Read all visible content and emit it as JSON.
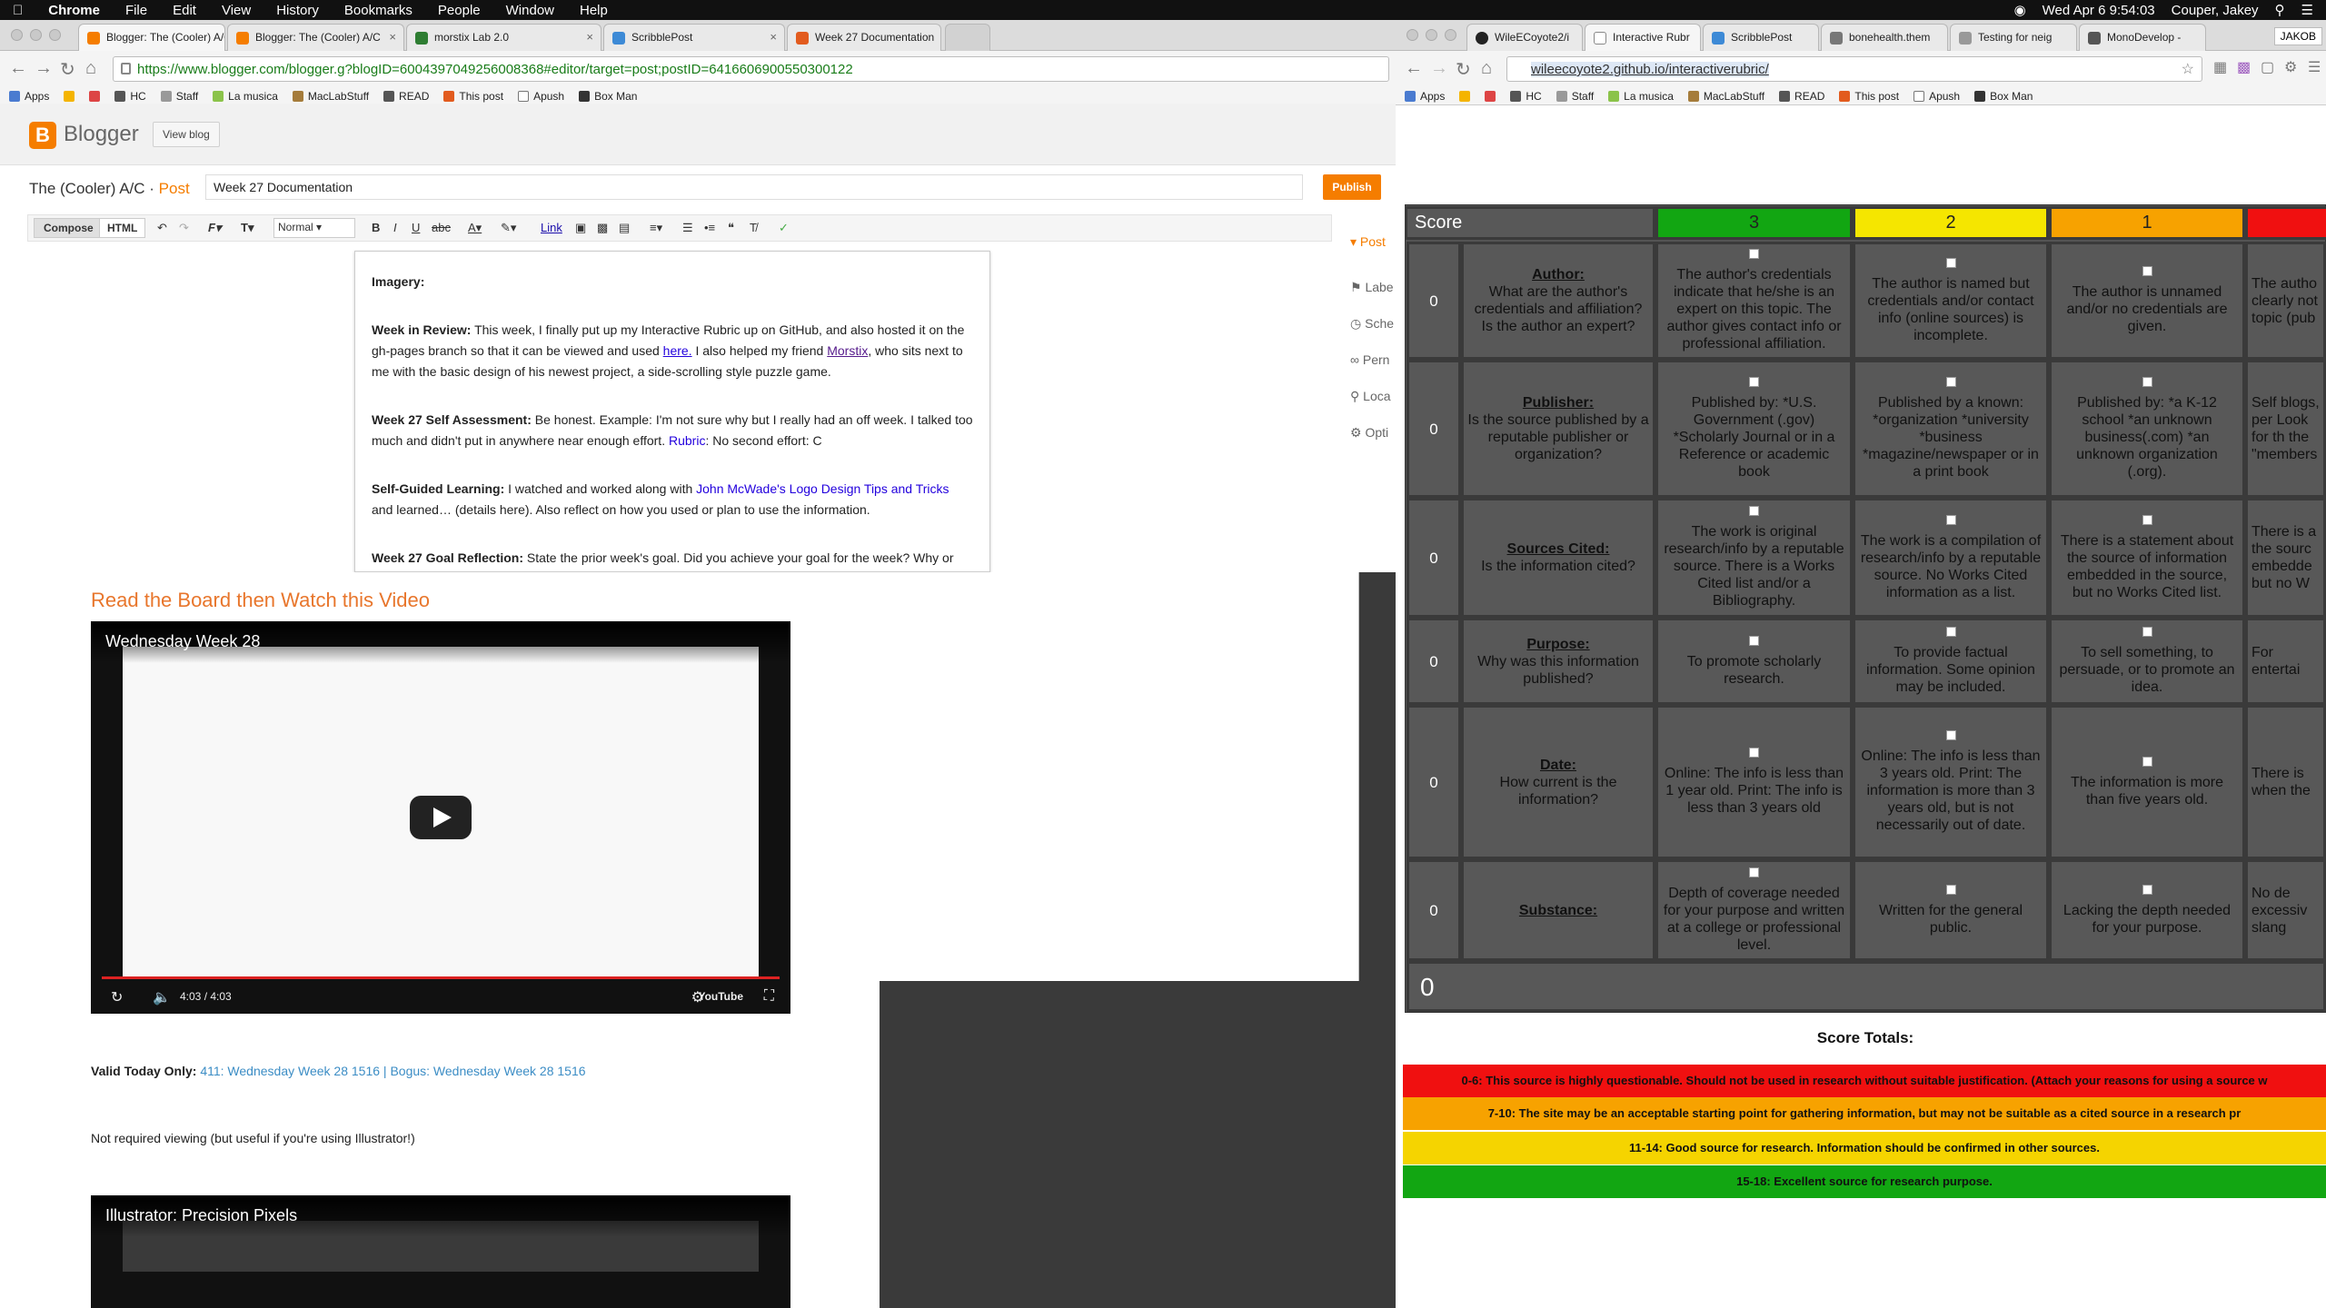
{
  "menubar": {
    "app": "Chrome",
    "items": [
      "File",
      "Edit",
      "View",
      "History",
      "Bookmarks",
      "People",
      "Window",
      "Help"
    ],
    "datetime": "Wed Apr 6  9:54:03",
    "user": "Couper, Jakey"
  },
  "left_browser": {
    "tabs": [
      {
        "label": "Blogger: The (Cooler) A/C",
        "color": "#f57d00"
      },
      {
        "label": "Blogger: The (Cooler) A/C",
        "color": "#f57d00"
      },
      {
        "label": "morstix Lab 2.0",
        "color": "#2e7d32"
      },
      {
        "label": "ScribblePost",
        "color": "#3d8ad6"
      },
      {
        "label": "Week 27 Documentation",
        "color": "#e25b1e"
      }
    ],
    "url": "https://www.blogger.com/blogger.g?blogID=6004397049256008368#editor/target=post;postID=6416606900550300122",
    "bookmarks": [
      "Apps",
      "HC",
      "Staff",
      "La musica",
      "MacLabStuff",
      "READ",
      "This post",
      "Apush",
      "Box Man"
    ]
  },
  "blogger": {
    "brand": "Blogger",
    "view_blog": "View blog",
    "blog_name": "The (Cooler) A/C",
    "separator": " · ",
    "section": "Post",
    "post_title": "Week 27 Documentation",
    "publish": "Publish",
    "compose": "Compose",
    "html": "HTML",
    "font_size": "Normal",
    "link": "Link",
    "sidebar": [
      "Post",
      "Labe",
      "Sche",
      "Pern",
      "Loca",
      "Opti"
    ],
    "content": {
      "imagery_label": "Imagery:",
      "review_label": "Week in Review:",
      "review_text_1": " This week, I finally put up my Interactive Rubric up on GitHub, and also hosted it on the gh-pages branch so that it can be viewed and used ",
      "review_link_1": "here.",
      "review_text_2": " I also helped my friend ",
      "review_link_2": "Morstix",
      "review_text_3": ", who sits next to me with the basic design of his newest project, a side-scrolling style puzzle game.",
      "self_label": "Week 27 Self Assessment:",
      "self_text": " Be honest. Example: I'm not sure why but I really had an off week. I talked too much and didn't put in anywhere near enough effort. ",
      "self_link": "Rubric",
      "self_text_2": ": No second effort: C",
      "guided_label": "Self-Guided Learning:",
      "guided_text_1": " I watched and worked along with ",
      "guided_link": "John McWade's Logo Design Tips and Tricks",
      "guided_text_2": " and learned… (details here). Also reflect on how you used or plan to use the information.",
      "goal_label": "Week 27 Goal Reflection:",
      "goal_text": " State the prior week's goal. Did you achieve your goal for the week? Why or"
    }
  },
  "background_page": {
    "heading": "Read the Board then Watch this Video",
    "video1_title": "Wednesday Week 28",
    "video1_time": "4:03 / 4:03",
    "valid_label": "Valid Today Only:",
    "valid_link_1": "411: Wednesday Week 28 1516",
    "valid_sep": " | ",
    "valid_link_2": "Bogus: Wednesday Week 28 1516",
    "note": "Not required viewing (but useful if you're using Illustrator!)",
    "video2_title": "Illustrator: Precision Pixels"
  },
  "right_browser": {
    "tabs": [
      {
        "label": "WileECoyote2/i",
        "color": "#222"
      },
      {
        "label": "Interactive Rubr",
        "color": "#888"
      },
      {
        "label": "ScribblePost",
        "color": "#3d8ad6"
      },
      {
        "label": "bonehealth.them",
        "color": "#777"
      },
      {
        "label": "Testing for neig",
        "color": "#999"
      },
      {
        "label": "MonoDevelop -",
        "color": "#555"
      }
    ],
    "profile": "JAKOB",
    "url": "wileecoyote2.github.io/interactiverubric/",
    "bookmarks": [
      "Apps",
      "HC",
      "Staff",
      "La musica",
      "MacLabStuff",
      "READ",
      "This post",
      "Apush",
      "Box Man"
    ]
  },
  "rubric": {
    "score_header": "Score",
    "levels": [
      {
        "label": "3",
        "color": "#12a612"
      },
      {
        "label": "2",
        "color": "#f5e600"
      },
      {
        "label": "1",
        "color": "#f7a200"
      },
      {
        "label": "",
        "color": "#f01010"
      }
    ],
    "rows": [
      {
        "score": "0",
        "criterion": "Author:",
        "question": "What are the author's credentials and affiliation? Is the author an expert?",
        "c3": "The author's credentials indicate that he/she is an expert on this topic. The author gives contact info or professional affiliation.",
        "c2": "The author is named but credentials and/or contact info (online sources) is incomplete.",
        "c1": "The author is unnamed and/or no credentials are given.",
        "c0": "The autho clearly not topic (pub"
      },
      {
        "score": "0",
        "criterion": "Publisher:",
        "question": "Is the source published by a reputable publisher or organization?",
        "c3": "Published by: *U.S. Government (.gov) *Scholarly Journal or in a Reference or academic book",
        "c2": "Published by a known: *organization *university *business *magazine/newspaper or in a print book",
        "c1": "Published by: *a K-12 school *an unknown business(.com) *an unknown organization (.org).",
        "c0": "Self blogs, per Look for th the \"members"
      },
      {
        "score": "0",
        "criterion": "Sources Cited:",
        "question": "Is the information cited?",
        "c3": "The work is original research/info by a reputable source. There is a Works Cited list and/or a Bibliography.",
        "c2": "The work is a compilation of research/info by a reputable source. No Works Cited information as a list.",
        "c1": "There is a statement about the source of information embedded in the source, but no Works Cited list.",
        "c0": "There is a the sourc embedde but no W"
      },
      {
        "score": "0",
        "criterion": "Purpose:",
        "question": "Why was this information published?",
        "c3": "To promote scholarly research.",
        "c2": "To provide factual information. Some opinion may be included.",
        "c1": "To sell something, to persuade, or to promote an idea.",
        "c0": "For entertai"
      },
      {
        "score": "0",
        "criterion": "Date:",
        "question": "How current is the information?",
        "c3": "Online: The info is less than 1 year old. Print: The info is less than 3 years old",
        "c2": "Online: The info is less than 3 years old. Print: The information is more than 3 years old, but is not necessarily out of date.",
        "c1": "The information is more than five years old.",
        "c0": "There is when the"
      },
      {
        "score": "0",
        "criterion": "Substance:",
        "question": "",
        "c3": "Depth of coverage needed for your purpose and written at a college or professional level.",
        "c2": "Written for the general public.",
        "c1": "Lacking the depth needed for your purpose.",
        "c0": "No de excessiv slang"
      }
    ],
    "total": "0",
    "totals_title": "Score Totals:",
    "bands": [
      {
        "text": "0-6: This source is highly questionable. Should not be used in research without suitable justification. (Attach your reasons for using a source w",
        "color": "#f01010"
      },
      {
        "text": "7-10: The site may be an acceptable starting point for gathering information, but may not be suitable as a cited source in a research pr",
        "color": "#f7a200"
      },
      {
        "text": "11-14: Good source for research. Information should be confirmed in other sources.",
        "color": "#f5d400"
      },
      {
        "text": "15-18: Excellent source for research purpose.",
        "color": "#12a612"
      }
    ]
  }
}
